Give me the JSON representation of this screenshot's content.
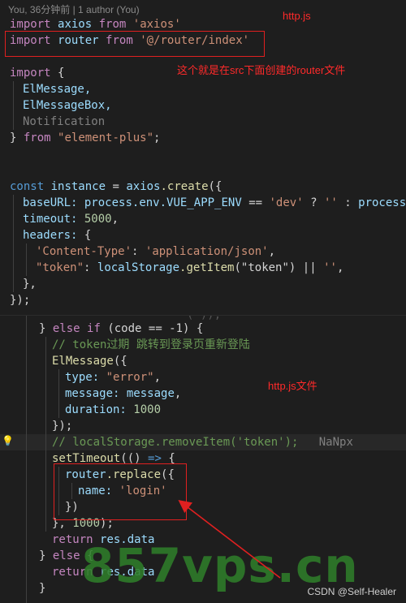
{
  "blame": "You, 36分钟前 | 1 author (You)",
  "annotations": {
    "http_js": "http.js",
    "router_note": "这个就是在src下面创建的router文件",
    "http_js_file": "http.js文件"
  },
  "code1": {
    "l1": {
      "kw": "import",
      "id": "axios",
      "from": "from",
      "str": "'axios'"
    },
    "l2": {
      "kw": "import",
      "id": "router",
      "from": "from",
      "str": "'@/router/index'"
    },
    "l3": {
      "kw": "import",
      "brace": "{"
    },
    "l4": "ElMessage,",
    "l5": "ElMessageBox,",
    "l6": "Notification",
    "l7": {
      "brace": "}",
      "from": "from",
      "str": "\"element-plus\"",
      "semi": ";"
    },
    "l8": {
      "kw": "const",
      "id": "instance",
      "eq": "=",
      "obj": "axios",
      "fn": ".create",
      "open": "({"
    },
    "l9": {
      "prop": "baseURL:",
      "obj": "process",
      "rest": ".env.",
      "var": "VUE_APP_ENV",
      "op": "==",
      "str1": "'dev'",
      "q": "?",
      "str2": "''",
      "colon": ":",
      "tail": "process.e"
    },
    "l10": {
      "prop": "timeout:",
      "num": "5000",
      "comma": ","
    },
    "l11": {
      "prop": "headers:",
      "open": "{"
    },
    "l12": {
      "key": "'Content-Type'",
      "colon": ":",
      "val": "'application/json'",
      "comma": ","
    },
    "l13": {
      "key": "\"token\"",
      "colon": ":",
      "obj": "localStorage",
      "fn": ".getItem",
      "arg": "(\"token\")",
      "or": "||",
      "str": "''",
      "comma": ","
    },
    "l14": "},",
    "l15": "});"
  },
  "code2": {
    "top_fragment": "( ));",
    "l1": {
      "brace": "}",
      "kw": "else if",
      "cond": "(code == -1) {"
    },
    "l2": "// token过期 跳转到登录页重新登陆",
    "l3": {
      "fn": "ElMessage",
      "open": "({"
    },
    "l4": {
      "prop": "type:",
      "str": "\"error\"",
      "comma": ","
    },
    "l5": {
      "prop": "message:",
      "val": "message",
      "comma": ","
    },
    "l6": {
      "prop": "duration:",
      "num": "1000"
    },
    "l7": "});",
    "l8": {
      "comment": "// localStorage.removeItem('token');",
      "hint": "NaNpx"
    },
    "l9": {
      "fn": "setTimeout",
      "paren": "((",
      "close": ")",
      "arrow": "=>",
      "open": "{"
    },
    "l10": {
      "obj": "router",
      "fn": ".replace",
      "open": "({"
    },
    "l11": {
      "prop": "name:",
      "str": "'login'"
    },
    "l12": "})",
    "l13": {
      "close": "},",
      "num": "1000",
      "end": ");"
    },
    "l14": {
      "kw": "return",
      "rest": "res.data"
    },
    "l15": {
      "brace": "}",
      "kw": "else",
      "open": "{"
    },
    "l16": {
      "kw": "return",
      "rest": "res.data"
    },
    "l17": "}"
  },
  "watermark": "857vps.cn",
  "credit": "CSDN @Self-Healer",
  "colors": {
    "background": "#1e1e1e",
    "annotation_red": "#ff2a2a",
    "keyword_blue": "#569cd6",
    "keyword_purple": "#c586c0",
    "string": "#ce9178",
    "comment": "#6a9955",
    "watermark_green": "#2f7d2a"
  },
  "icons": [
    "lightbulb-icon"
  ]
}
